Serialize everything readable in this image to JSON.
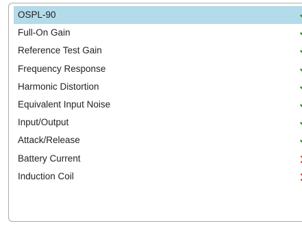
{
  "checklist": {
    "items": [
      {
        "label": "OSPL-90",
        "status": "pass",
        "selected": true
      },
      {
        "label": "Full-On Gain",
        "status": "pass",
        "selected": false
      },
      {
        "label": "Reference Test Gain",
        "status": "pass",
        "selected": false
      },
      {
        "label": "Frequency Response",
        "status": "pass",
        "selected": false
      },
      {
        "label": "Harmonic Distortion",
        "status": "pass",
        "selected": false
      },
      {
        "label": "Equivalent Input Noise",
        "status": "pass",
        "selected": false
      },
      {
        "label": "Input/Output",
        "status": "pass",
        "selected": false
      },
      {
        "label": "Attack/Release",
        "status": "pass",
        "selected": false
      },
      {
        "label": "Battery Current",
        "status": "fail",
        "selected": false
      },
      {
        "label": "Induction Coil",
        "status": "fail",
        "selected": false
      }
    ]
  },
  "colors": {
    "selected_bg": "#b3dbea",
    "pass": "#2e8b2e",
    "fail": "#c0392b"
  },
  "icons": {
    "pass": "check-icon",
    "fail": "x-icon"
  }
}
